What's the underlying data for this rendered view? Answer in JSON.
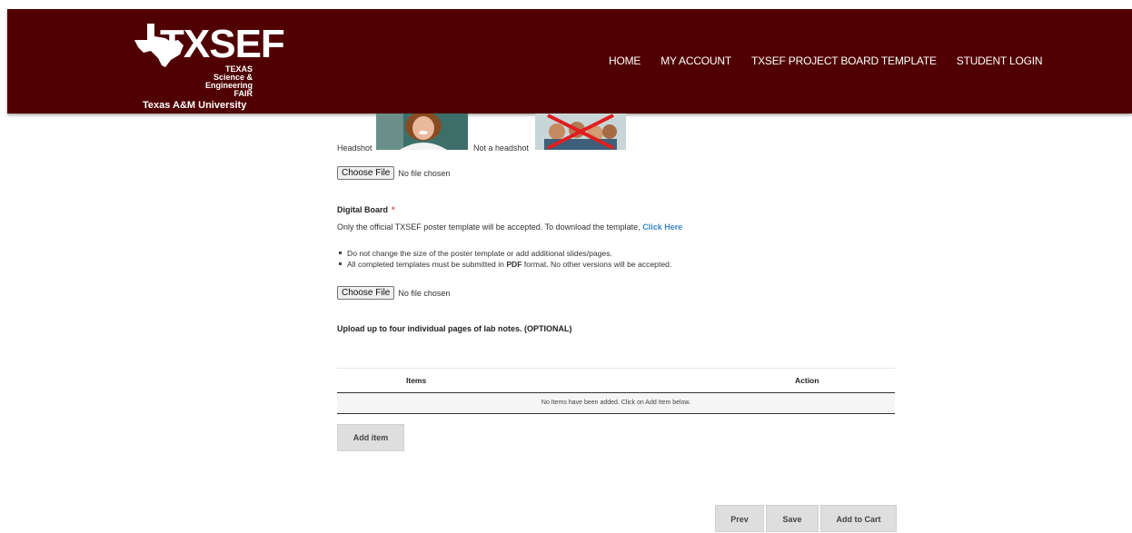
{
  "header": {
    "logo_main": "TXSEF",
    "logo_sub1": "TEXAS Science &",
    "logo_sub2": "Engineering FAIR",
    "logo_univ": "Texas A&M University",
    "nav": [
      "HOME",
      "MY ACCOUNT",
      "TXSEF PROJECT BOARD TEMPLATE",
      "STUDENT LOGIN"
    ],
    "bg_color": "#500000"
  },
  "photos": {
    "headshot_caption": "Headshot",
    "not_headshot_caption": "Not a headshot"
  },
  "file_input_1": {
    "button": "Choose File",
    "status": "No file chosen"
  },
  "digital_board": {
    "label": "Digital Board",
    "required_mark": "*",
    "intro": "Only the official TXSEF poster template will be accepted. To download the template, ",
    "link_text": "Click Here",
    "bullet1": "Do not change the size of the poster template or add additional slides/pages.",
    "bullet2_pre": "All completed templates must be submitted in ",
    "bullet2_bold": "PDF",
    "bullet2_post": " format. No other versions will be accepted."
  },
  "file_input_2": {
    "button": "Choose File",
    "status": "No file chosen"
  },
  "lab_notes": {
    "label": "Upload up to four individual pages of lab notes. (OPTIONAL)"
  },
  "items_table": {
    "headers": [
      "Items",
      "Action"
    ],
    "empty_text": "No Items have been added. Click on Add Item below."
  },
  "add_item_button": "Add item",
  "footer_buttons": {
    "prev": "Prev",
    "save": "Save",
    "add_to_cart": "Add to Cart"
  }
}
